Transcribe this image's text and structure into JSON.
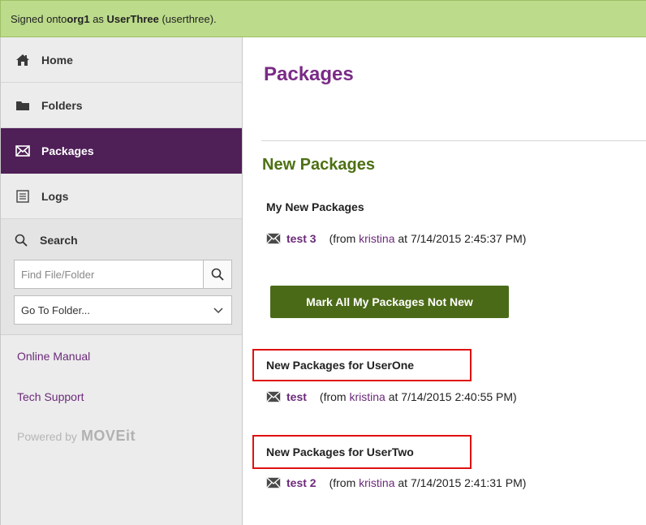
{
  "topbar": {
    "prefix": "Signed onto ",
    "org": "org1",
    "as_text": " as ",
    "user_display": "UserThree",
    "user_login": " (userthree)."
  },
  "sidebar": {
    "items": [
      {
        "label": "Home",
        "icon": "home-icon"
      },
      {
        "label": "Folders",
        "icon": "folder-icon"
      },
      {
        "label": "Packages",
        "icon": "envelope-icon",
        "active": true
      },
      {
        "label": "Logs",
        "icon": "logs-icon"
      }
    ],
    "search": {
      "title": "Search",
      "placeholder": "Find File/Folder",
      "go_to_folder": "Go To Folder..."
    },
    "links": {
      "manual": "Online Manual",
      "support": "Tech Support"
    },
    "powered_by": "Powered by",
    "brand": "MOVEit"
  },
  "main": {
    "title": "Packages",
    "section_title": "New Packages",
    "my_packages": {
      "heading": "My New Packages",
      "package": {
        "name": "test 3",
        "from_prefix": "(from ",
        "sender": "kristina",
        "at_text": " at 7/14/2015 2:45:37 PM)"
      }
    },
    "mark_button": "Mark All My Packages Not New",
    "userone": {
      "heading": "New Packages for UserOne",
      "package": {
        "name": "test",
        "from_prefix": "(from ",
        "sender": "kristina",
        "at_text": " at 7/14/2015 2:40:55 PM)"
      }
    },
    "usertwo": {
      "heading": "New Packages for UserTwo",
      "package": {
        "name": "test 2",
        "from_prefix": "(from ",
        "sender": "kristina",
        "at_text": " at 7/14/2015 2:41:31 PM)"
      }
    }
  },
  "colors": {
    "topbar_bg": "#bcdb8b",
    "active_nav": "#4f1f57",
    "title_purple": "#7a2b86",
    "section_green": "#4d7013",
    "button_green": "#4b6a17",
    "highlight_red": "#e01010"
  }
}
